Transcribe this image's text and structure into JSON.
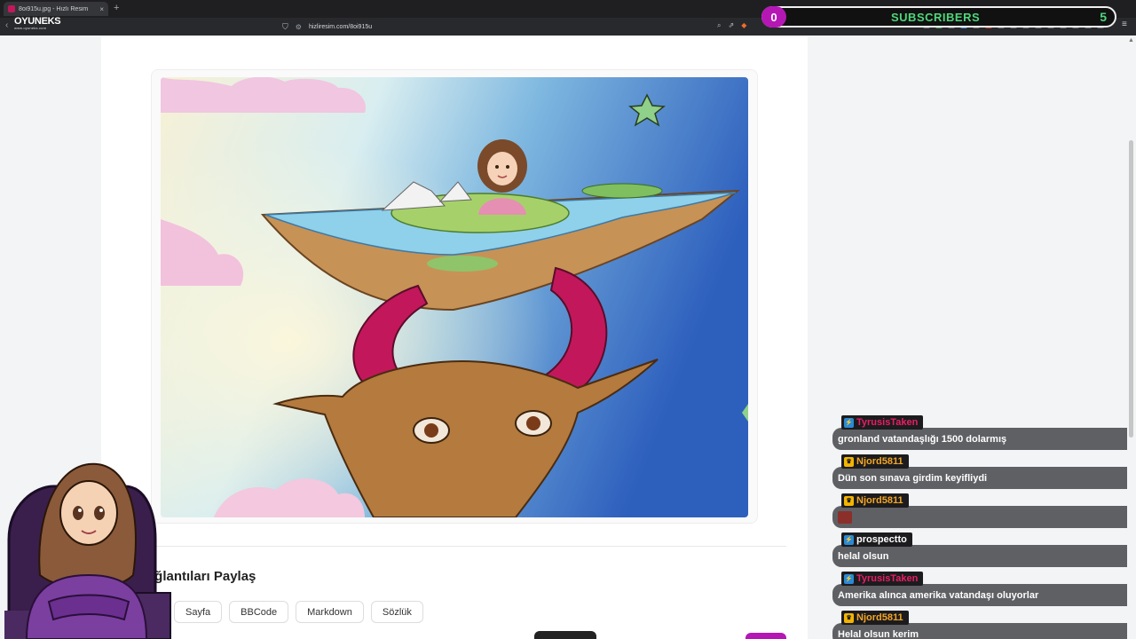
{
  "browser": {
    "tab_title": "8oi915u.jpg - Hızlı Resim",
    "tab_close": "×",
    "new_tab": "+",
    "url": "hizliresim.com/8oi915u"
  },
  "overlay": {
    "logo": "OYUNEKS",
    "logo_sub": "www.oyuneks.com",
    "subscribers_label": "SUBSCRIBERS",
    "subscribers_start": "0",
    "subscribers_goal": "5"
  },
  "share": {
    "title": "Bağlantıları Paylaş",
    "buttons": [
      "Sayfa",
      "BBCode",
      "Markdown",
      "Sözlük"
    ]
  },
  "chat": {
    "messages": [
      {
        "user": "TyrusisTaken",
        "color": "#e91e63",
        "badge": "prime",
        "text": "gronland vatandaşlığı 1500 dolarmış"
      },
      {
        "user": "Njord5811",
        "color": "#f5a623",
        "badge": "crown",
        "text": "Dün son sınava girdim keyifliydi"
      },
      {
        "user": "Njord5811",
        "color": "#f5a623",
        "badge": "crown",
        "text": ""
      },
      {
        "user": "prospectto",
        "color": "#ffffff",
        "badge": "prime",
        "text": "helal olsun"
      },
      {
        "user": "TyrusisTaken",
        "color": "#e91e63",
        "badge": "prime",
        "text": "Amerika alınca amerika vatandaşı oluyorlar"
      },
      {
        "user": "Njord5811",
        "color": "#f5a623",
        "badge": "crown",
        "text": "Helal olsun kerim"
      }
    ]
  },
  "colors": {
    "accent_pink": "#e91e63",
    "widget_purple": "#b517b5",
    "subscriber_green": "#4fd67c"
  }
}
